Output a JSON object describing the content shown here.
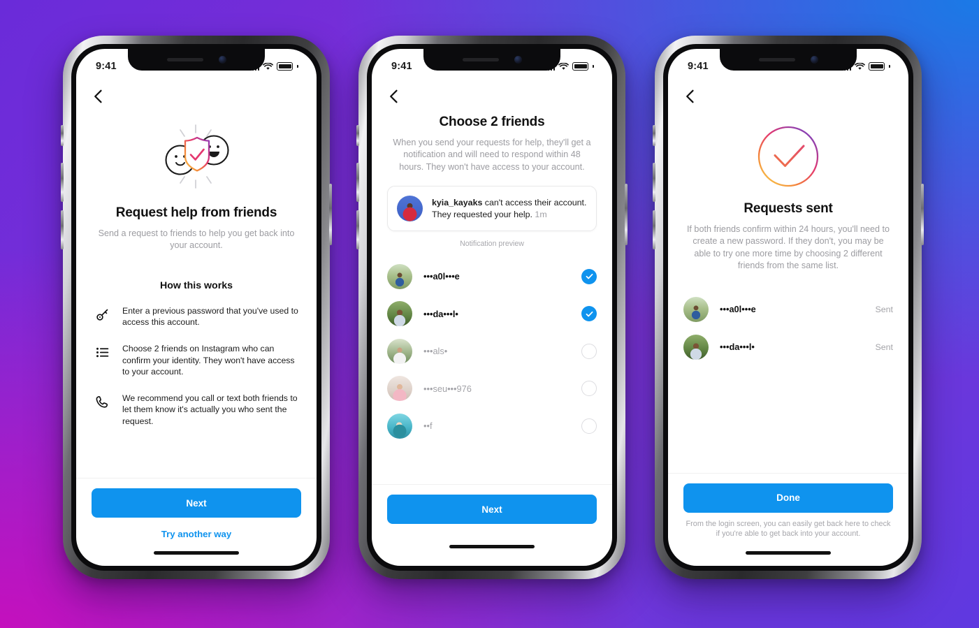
{
  "background": {
    "top_left": "#6a2bd9",
    "top_right": "#1a7ae6",
    "bottom_left": "#c410bd",
    "bottom_right": "#5f38e0"
  },
  "accent_color": "#0f93ee",
  "status_bar": {
    "time": "9:41",
    "signal_icon": "cellular-bars-icon",
    "wifi_icon": "wifi-icon",
    "battery_icon": "battery-full-icon"
  },
  "screens": [
    {
      "id": "request-help",
      "back_icon": "chevron-left-icon",
      "illustration": "friends-shield-check-illustration",
      "title": "Request help from friends",
      "subtitle": "Send a request to friends to help you get back into your account.",
      "section_heading": "How this works",
      "steps": [
        {
          "icon": "key-icon",
          "text": "Enter a previous password that you've used to access this account."
        },
        {
          "icon": "list-icon",
          "text": "Choose 2 friends on Instagram who can confirm your identity. They won't have access to your account."
        },
        {
          "icon": "phone-icon",
          "text": "We recommend you call or text both friends to let them know it's actually you who sent the request."
        }
      ],
      "primary_button": "Next",
      "secondary_link": "Try another way"
    },
    {
      "id": "choose-friends",
      "back_icon": "chevron-left-icon",
      "title": "Choose 2 friends",
      "subtitle": "When you send your requests for help, they'll get a notification and will need to respond within 48 hours. They won't have access to your account.",
      "notification": {
        "avatar": "kyia-kayaks-avatar",
        "username": "kyia_kayaks",
        "body": " can't access their account. They requested your help.",
        "timestamp": "1m",
        "caption": "Notification preview"
      },
      "friends": [
        {
          "avatar": "friend-avatar-1",
          "name": "•••a0l•••e",
          "selected": true,
          "check_icon": "check-circle-filled-icon"
        },
        {
          "avatar": "friend-avatar-2",
          "name": "•••da•••l•",
          "selected": true,
          "check_icon": "check-circle-filled-icon"
        },
        {
          "avatar": "friend-avatar-3",
          "name": "•••als•",
          "selected": false,
          "check_icon": "circle-empty-icon"
        },
        {
          "avatar": "friend-avatar-4",
          "name": "•••seu•••976",
          "selected": false,
          "check_icon": "circle-empty-icon"
        },
        {
          "avatar": "friend-avatar-5",
          "name": "••f",
          "selected": false,
          "check_icon": "circle-empty-icon"
        }
      ],
      "primary_button": "Next"
    },
    {
      "id": "requests-sent",
      "back_icon": "chevron-left-icon",
      "illustration": "gradient-check-circle-illustration",
      "title": "Requests sent",
      "subtitle": "If both friends confirm within 24 hours, you'll need to create a new password. If they don't, you may be able to try one more time by choosing 2 different friends from the same list.",
      "sent": [
        {
          "avatar": "friend-avatar-1",
          "name": "•••a0l•••e",
          "status": "Sent"
        },
        {
          "avatar": "friend-avatar-2",
          "name": "•••da•••l•",
          "status": "Sent"
        }
      ],
      "primary_button": "Done",
      "footnote": "From the login screen, you can easily get back here to check if you're able to get back into your account."
    }
  ]
}
